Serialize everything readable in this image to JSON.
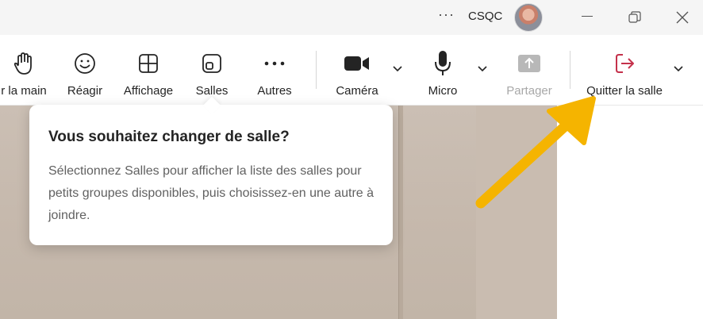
{
  "titlebar": {
    "more_label": "···",
    "org": "CSQC"
  },
  "toolbar": {
    "raise_hand": "r la main",
    "react": "Réagir",
    "view": "Affichage",
    "rooms": "Salles",
    "more": "Autres",
    "camera": "Caméra",
    "mic": "Micro",
    "share": "Partager",
    "leave": "Quitter la salle"
  },
  "popover": {
    "title": "Vous souhaitez changer de salle?",
    "body": "Sélectionnez Salles pour afficher la liste des salles pour petits groupes disponibles, puis choisissez-en une autre à joindre."
  },
  "colors": {
    "leave_accent": "#c4314b",
    "annotation_arrow": "#f5b400"
  },
  "icons": [
    "hand-icon",
    "smiley-icon",
    "grid-icon",
    "rooms-icon",
    "more-dots-icon",
    "camera-icon",
    "mic-icon",
    "share-icon",
    "leave-icon",
    "chevron-down-icon",
    "minimize-icon",
    "restore-icon",
    "close-icon"
  ]
}
